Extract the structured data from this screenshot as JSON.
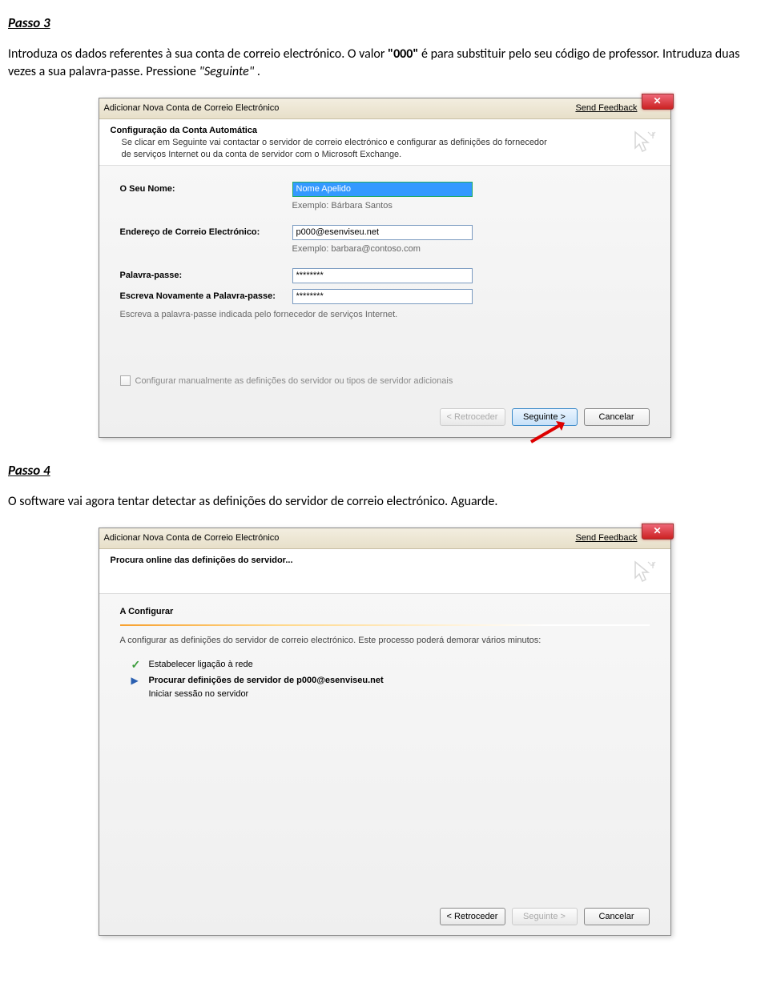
{
  "passo3": {
    "heading": "Passo 3",
    "text_prefix": "Introduza os dados referentes à sua conta de correio electrónico. O valor ",
    "text_bold": "\"000\"",
    "text_mid": " é para substituir pelo seu código de professor. Intruduza duas vezes a sua palavra-passe. Pressione ",
    "text_italic": "\"Seguinte\"",
    "text_suffix": "."
  },
  "dialog1": {
    "title": "Adicionar Nova Conta de Correio Electrónico",
    "send_feedback": "Send Feedback",
    "header_title": "Configuração da Conta Automática",
    "header_sub": "Se clicar em Seguinte vai contactar o servidor de correio electrónico e configurar as definições do fornecedor de serviços Internet ou da conta de servidor com o Microsoft Exchange.",
    "fields": {
      "name_label": "O Seu Nome:",
      "name_value": "Nome Apelido",
      "name_example": "Exemplo: Bárbara Santos",
      "email_label": "Endereço de Correio Electrónico:",
      "email_value": "p000@esenviseu.net",
      "email_example": "Exemplo: barbara@contoso.com",
      "pass_label": "Palavra-passe:",
      "pass_value": "********",
      "pass2_label": "Escreva Novamente a Palavra-passe:",
      "pass2_value": "********",
      "pass_hint": "Escreva a palavra-passe indicada pelo fornecedor de serviços Internet."
    },
    "checkbox": "Configurar manualmente as definições do servidor ou tipos de servidor adicionais",
    "buttons": {
      "back": "< Retroceder",
      "next": "Seguinte >",
      "cancel": "Cancelar"
    }
  },
  "passo4": {
    "heading": "Passo 4",
    "text": "O software vai agora tentar detectar as definições do servidor de correio electrónico. Aguarde."
  },
  "dialog2": {
    "title": "Adicionar Nova Conta de Correio Electrónico",
    "send_feedback": "Send Feedback",
    "header_title": "Procura online das definições do servidor...",
    "section_title": "A Configurar",
    "desc": "A configurar as definições do servidor de correio electrónico. Este processo poderá demorar vários minutos:",
    "steps": {
      "s1": "Estabelecer ligação à rede",
      "s2": "Procurar definições de servidor de p000@esenviseu.net",
      "s3": "Iniciar sessão no servidor"
    },
    "buttons": {
      "back": "< Retroceder",
      "next": "Seguinte >",
      "cancel": "Cancelar"
    }
  }
}
